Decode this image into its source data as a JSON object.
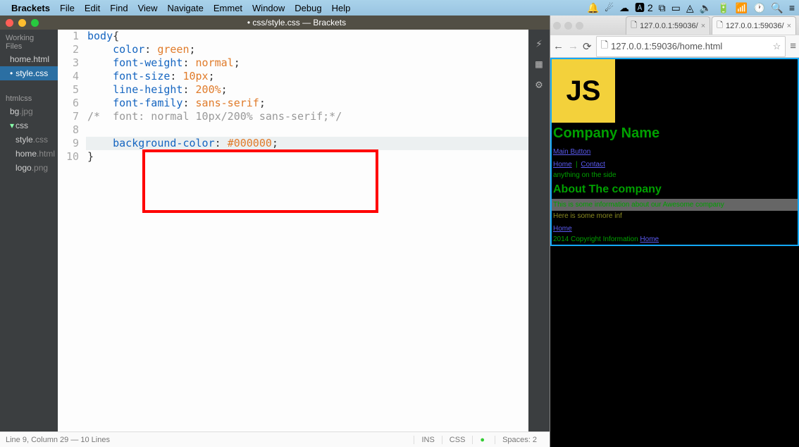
{
  "menubar": {
    "app": "Brackets",
    "items": [
      "File",
      "Edit",
      "Find",
      "View",
      "Navigate",
      "Emmet",
      "Window",
      "Debug",
      "Help"
    ]
  },
  "brackets": {
    "title_prefix": "• css/style.css — Brackets",
    "sidebar": {
      "working_label": "Working Files",
      "working_items": [
        "home.html",
        "style.css"
      ],
      "project_label": "htmlcss",
      "files": [
        "bg.jpg"
      ],
      "folder": "css",
      "folder_files": [
        "style.css",
        "home.html",
        "logo.png"
      ]
    },
    "code": {
      "lines": [
        {
          "n": "1",
          "sel": "body",
          "punct": "{"
        },
        {
          "n": "2",
          "indent": "    ",
          "sel": "color",
          "punct": ": ",
          "val": "green",
          "end": ";"
        },
        {
          "n": "3",
          "indent": "    ",
          "sel": "font-weight",
          "punct": ": ",
          "val": "normal",
          "end": ";"
        },
        {
          "n": "4",
          "indent": "    ",
          "sel": "font-size",
          "punct": ": ",
          "val": "10px",
          "end": ";"
        },
        {
          "n": "5",
          "indent": "    ",
          "sel": "line-height",
          "punct": ": ",
          "val": "200%",
          "end": ";"
        },
        {
          "n": "6",
          "indent": "    ",
          "sel": "font-family",
          "punct": ": ",
          "val": "sans-serif",
          "end": ";"
        },
        {
          "n": "7",
          "com": "/*  font: normal 10px/200% sans-serif;*/"
        },
        {
          "n": "8"
        },
        {
          "n": "9",
          "indent": "    ",
          "sel": "background-color",
          "punct": ": ",
          "val": "#000000",
          "end": ";"
        },
        {
          "n": "10",
          "punct": "}"
        }
      ]
    },
    "status": {
      "pos": "Line 9, Column 29 — 10 Lines",
      "ins": "INS",
      "lang": "CSS",
      "ind": "Spaces: 2"
    }
  },
  "chrome": {
    "tab1": "127.0.0.1:59036/",
    "tab2": "127.0.0.1:59036/",
    "url": "127.0.0.1:59036/home.html"
  },
  "page": {
    "logo": "JS",
    "title": "Company Name",
    "btn": "Main Button",
    "nav_home": "Home",
    "nav_sep": " | ",
    "nav_contact": "Contact",
    "side": "anything on the side",
    "about": "About The company",
    "banner": "This is some information about our Awesome company",
    "more": "Here is some more inf",
    "foot_link": "Home",
    "copy": "2014 Copyright Information ",
    "copy_link": "Home"
  }
}
